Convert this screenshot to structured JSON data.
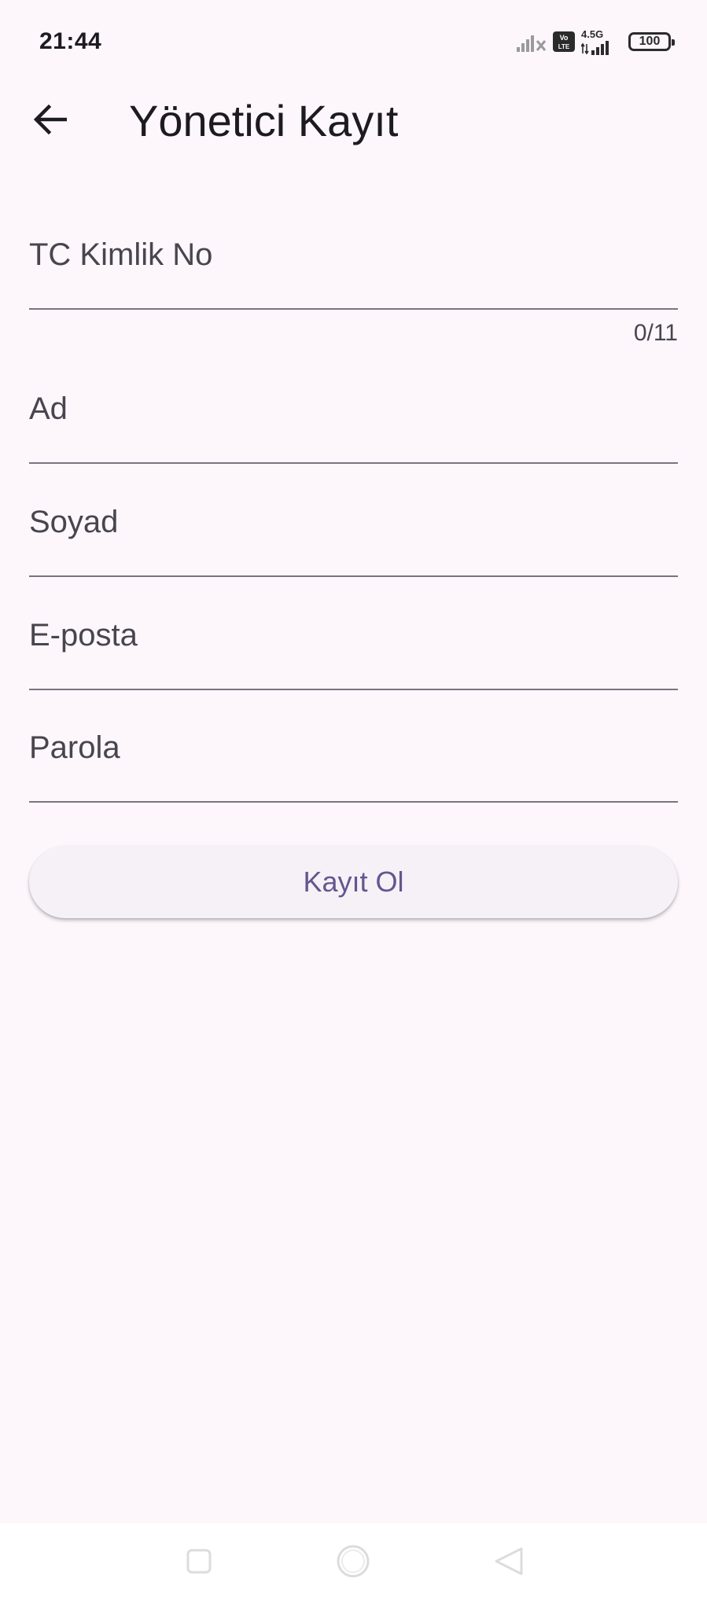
{
  "status_bar": {
    "time": "21:44",
    "network": "4.5G",
    "volte": "Vo LTE",
    "battery": "100"
  },
  "app_bar": {
    "title": "Yönetici Kayıt"
  },
  "form": {
    "tc_label": "TC Kimlik No",
    "tc_value": "",
    "tc_counter": "0/11",
    "first_name_label": "Ad",
    "first_name_value": "",
    "last_name_label": "Soyad",
    "last_name_value": "",
    "email_label": "E-posta",
    "email_value": "",
    "password_label": "Parola",
    "password_value": "",
    "submit_label": "Kayıt Ol"
  },
  "colors": {
    "background": "#fdf7fc",
    "primary": "#65558f",
    "underline": "#79747e",
    "label": "#49454f"
  }
}
